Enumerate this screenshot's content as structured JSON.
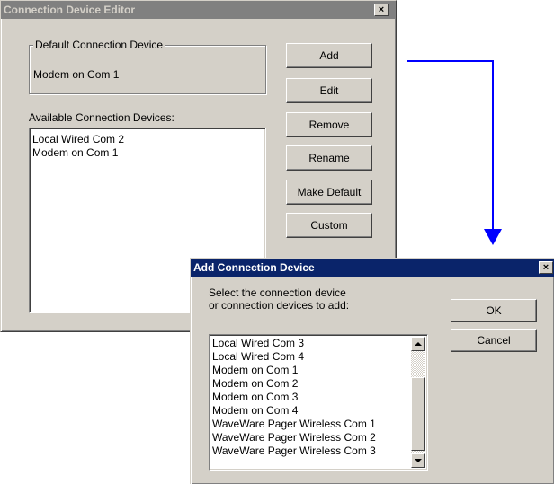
{
  "editor": {
    "title": "Connection Device Editor",
    "close_glyph": "×",
    "default_group_label": "Default Connection Device",
    "default_device": "Modem on Com 1",
    "available_label": "Available Connection Devices:",
    "devices": [
      "Local Wired Com 2",
      "Modem on Com 1"
    ],
    "buttons": {
      "add": "Add",
      "edit": "Edit",
      "remove": "Remove",
      "rename": "Rename",
      "make_default": "Make Default",
      "custom": "Custom"
    }
  },
  "add_dialog": {
    "title": "Add Connection Device",
    "close_glyph": "×",
    "instruction_line1": "Select the connection device",
    "instruction_line2": "or connection devices to add:",
    "ok": "OK",
    "cancel": "Cancel",
    "devices": [
      "Local Wired Com 3",
      "Local Wired Com 4",
      "Modem on Com 1",
      "Modem on Com 2",
      "Modem on Com 3",
      "Modem on Com 4",
      "WaveWare Pager Wireless Com 1",
      "WaveWare Pager Wireless Com 2",
      "WaveWare Pager Wireless Com 3"
    ]
  },
  "colors": {
    "arrow": "#0000ff",
    "active_title": "#0a246a",
    "inactive_title": "#808080",
    "face": "#d4d0c8"
  },
  "icons": [
    "close-icon",
    "scroll-up-arrow-icon",
    "scroll-down-arrow-icon",
    "flow-arrow-icon"
  ]
}
